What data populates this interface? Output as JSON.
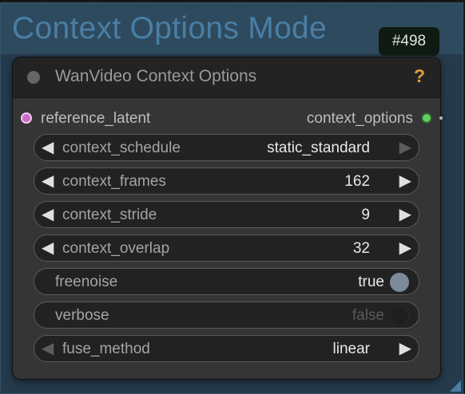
{
  "group": {
    "title": "Context Options Mode"
  },
  "node": {
    "id_badge": "#498",
    "title": "WanVideo Context Options",
    "help_glyph": "?",
    "input_slot": "reference_latent",
    "output_slot": "context_options",
    "widgets": [
      {
        "label": "context_schedule",
        "value": "static_standard",
        "type": "combo"
      },
      {
        "label": "context_frames",
        "value": "162",
        "type": "number"
      },
      {
        "label": "context_stride",
        "value": "9",
        "type": "number"
      },
      {
        "label": "context_overlap",
        "value": "32",
        "type": "number"
      },
      {
        "label": "freenoise",
        "value": "true",
        "type": "toggle",
        "on": true
      },
      {
        "label": "verbose",
        "value": "false",
        "type": "toggle",
        "on": false
      },
      {
        "label": "fuse_method",
        "value": "linear",
        "type": "combo"
      }
    ]
  },
  "glyphs": {
    "arrow_left": "◀",
    "arrow_right": "▶"
  },
  "colors": {
    "group_title": "#4a7ea3",
    "input_slot": "#c86ac8",
    "output_slot": "#5fd05f",
    "help": "#e09c3a"
  }
}
